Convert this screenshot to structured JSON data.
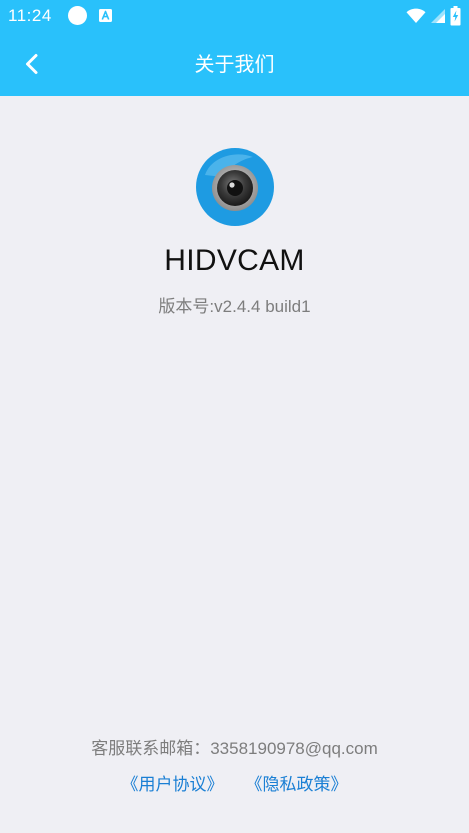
{
  "status_bar": {
    "time": "11:24",
    "left_icons": [
      "circle-notification-icon",
      "app-a-icon"
    ],
    "right_icons": [
      "wifi-icon",
      "cell-signal-icon",
      "battery-charging-icon"
    ]
  },
  "header": {
    "title": "关于我们",
    "back_icon": "chevron-left-icon"
  },
  "app": {
    "logo_icon": "camera-lens-logo-icon",
    "name": "HIDVCAM",
    "version_label": "版本号:",
    "version": "v2.4.4 build1"
  },
  "footer": {
    "contact_label": "客服联系邮箱：",
    "contact_email": "3358190978@qq.com",
    "user_agreement": "《用户协议》",
    "privacy_policy": "《隐私政策》"
  },
  "colors": {
    "header_bg": "#29c1fb",
    "page_bg": "#efeff4",
    "link": "#1a7fd4",
    "muted_text": "#7d7d7d",
    "title_text": "#111111"
  }
}
